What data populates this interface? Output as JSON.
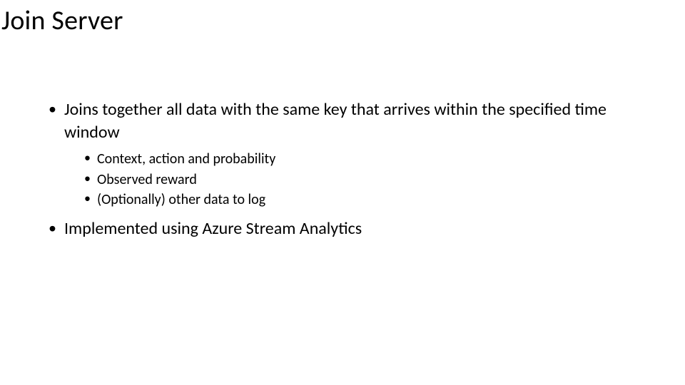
{
  "title": "Join Server",
  "bullets": {
    "item1": "Joins together all data with the same key that arrives within the specified time window",
    "item1_sub1": "Context, action and probability",
    "item1_sub2": "Observed reward",
    "item1_sub3": "(Optionally) other data to log",
    "item2": "Implemented using Azure Stream Analytics"
  }
}
